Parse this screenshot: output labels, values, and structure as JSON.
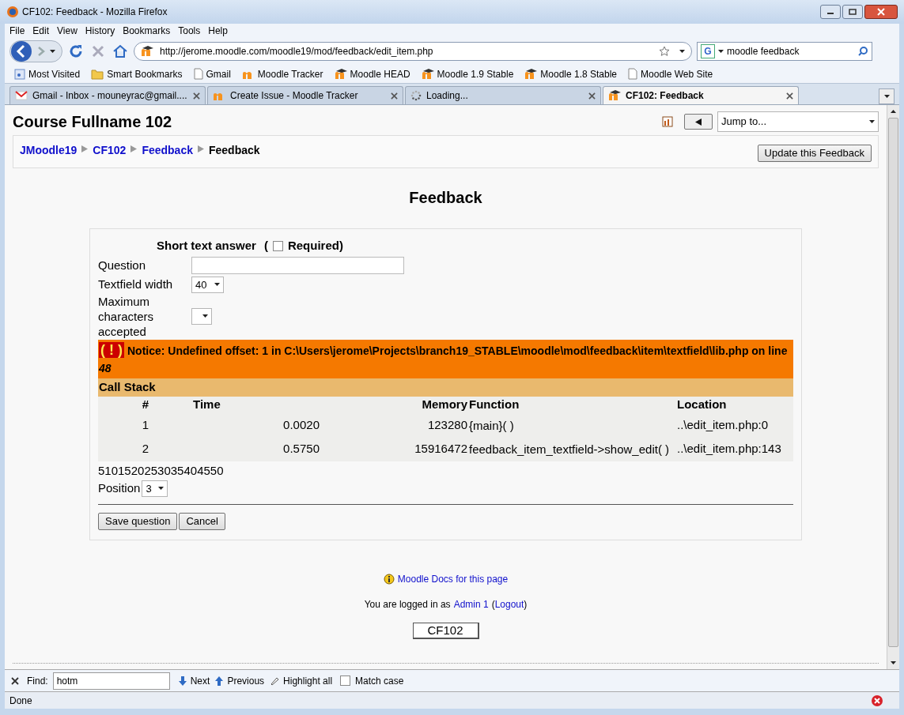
{
  "window": {
    "title": "CF102: Feedback - Mozilla Firefox"
  },
  "menu": [
    "File",
    "Edit",
    "View",
    "History",
    "Bookmarks",
    "Tools",
    "Help"
  ],
  "address": {
    "value": "http://jerome.moodle.com/moodle19/mod/feedback/edit_item.php"
  },
  "search": {
    "engine": "G",
    "value": "moodle feedback"
  },
  "bookmarks": [
    {
      "label": "Most Visited",
      "kind": "rss"
    },
    {
      "label": "Smart Bookmarks",
      "kind": "folder"
    },
    {
      "label": "Gmail",
      "kind": "page"
    },
    {
      "label": "Moodle Tracker",
      "kind": "moodle"
    },
    {
      "label": "Moodle HEAD",
      "kind": "moodlecap"
    },
    {
      "label": "Moodle 1.9 Stable",
      "kind": "moodlecap"
    },
    {
      "label": "Moodle 1.8 Stable",
      "kind": "moodlecap"
    },
    {
      "label": "Moodle Web Site",
      "kind": "page"
    }
  ],
  "tabs": [
    {
      "label": "Gmail - Inbox - mouneyrac@gmail....",
      "kind": "gmail",
      "selected": false
    },
    {
      "label": "Create Issue - Moodle Tracker",
      "kind": "moodle",
      "selected": false
    },
    {
      "label": "Loading...",
      "kind": "loading",
      "selected": false
    },
    {
      "label": "CF102: Feedback",
      "kind": "moodlecap",
      "selected": true
    }
  ],
  "page": {
    "course_title": "Course Fullname 102",
    "jump": "Jump to...",
    "breadcrumb": [
      {
        "label": "JMoodle19",
        "link": true
      },
      {
        "label": "CF102",
        "link": true
      },
      {
        "label": "Feedback",
        "link": true
      },
      {
        "label": "Feedback",
        "link": false
      }
    ],
    "update_button": "Update this Feedback",
    "heading": "Feedback",
    "item_title": "Short text answer",
    "required_open": "(",
    "required_label": "Required)",
    "required_checked": false,
    "question_label": "Question",
    "width_label": "Textfield width",
    "width_value": "40",
    "max_label": "Maximum characters accepted",
    "notice": {
      "icon": "( ! )",
      "text": "Notice: Undefined offset: 1 in C:\\Users\\jerome\\Projects\\branch19_STABLE\\moodle\\mod\\feedback\\item\\textfield\\lib.php on line *48*"
    },
    "call_stack": {
      "title": "Call Stack",
      "columns": [
        "#",
        "Time",
        "Memory",
        "Function",
        "Location"
      ],
      "rows": [
        [
          "1",
          "0.0020",
          "123280",
          "{main}( )",
          "..\\edit_item.php:0"
        ],
        [
          "2",
          "0.5750",
          "15916472",
          "feedback_item_textfield->show_edit( )",
          "..\\edit_item.php:143"
        ]
      ]
    },
    "stray_numbers": "5101520253035404550",
    "position_label": "Position",
    "position_value": "3",
    "buttons": [
      "Save question",
      "Cancel"
    ],
    "docs_link": "Moodle Docs for this page",
    "logged_in_text": "You are logged in as",
    "user_link": "Admin 1",
    "logout_open": "(",
    "logout_link": "Logout",
    "logout_close": ")",
    "course_button": "CF102"
  },
  "find_bar": {
    "label": "Find:",
    "value": "hotm",
    "next": "Next",
    "previous": "Previous",
    "highlight": "Highlight all",
    "match_case": "Match case",
    "match_case_checked": false
  },
  "status_bar": {
    "text": "Done"
  }
}
